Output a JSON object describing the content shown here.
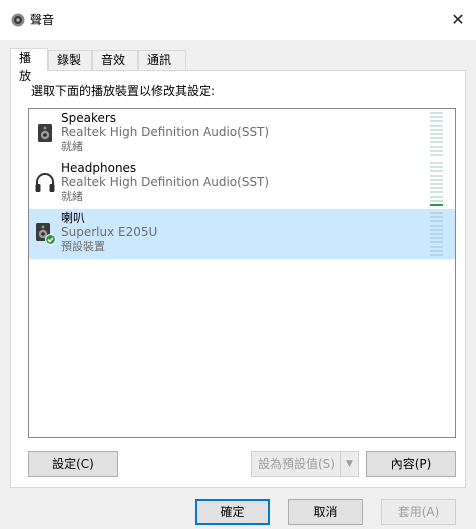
{
  "window": {
    "title": "聲音",
    "close_label": "✕"
  },
  "tabs": [
    {
      "label": "播放"
    },
    {
      "label": "錄製"
    },
    {
      "label": "音效"
    },
    {
      "label": "通訊"
    }
  ],
  "panel": {
    "instruction": "選取下面的播放裝置以修改其設定:",
    "devices": [
      {
        "name": "Speakers",
        "driver": "Realtek High Definition Audio(SST)",
        "status": "就緒",
        "icon": "speaker-icon",
        "selected": false,
        "level": 0
      },
      {
        "name": "Headphones",
        "driver": "Realtek High Definition Audio(SST)",
        "status": "就緒",
        "icon": "headphones-icon",
        "selected": false,
        "level": 0.08
      },
      {
        "name": "喇叭",
        "driver": "Superlux E205U",
        "status": "預設裝置",
        "icon": "speaker-default-icon",
        "selected": true,
        "level": 0
      }
    ],
    "buttons": {
      "configure": "設定(C)",
      "set_default": "設為預設值(S)",
      "properties": "內容(P)"
    }
  },
  "footer": {
    "ok": "確定",
    "cancel": "取消",
    "apply": "套用(A)"
  },
  "colors": {
    "selection": "#cce8ff",
    "accent": "#0078d7",
    "meter_lit": "#2e9c44"
  }
}
